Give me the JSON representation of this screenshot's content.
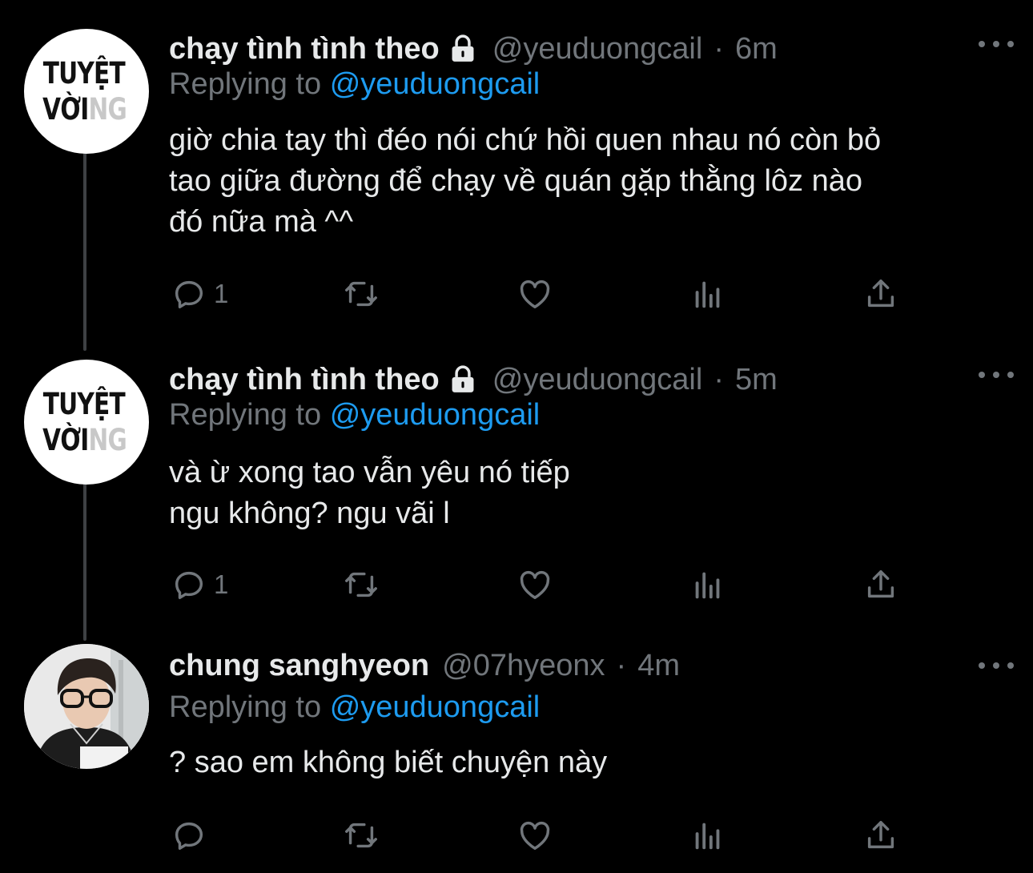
{
  "colors": {
    "background": "#000000",
    "text": "#e7e9ea",
    "muted": "#71767b",
    "accent": "#1d9bf0"
  },
  "tweets": [
    {
      "avatar": {
        "line1": "TUYỆT",
        "line2_main": "VỜI",
        "line2_faded": "NG"
      },
      "name": "chạy tình tình theo",
      "locked": true,
      "handle": "@yeuduongcail",
      "time": "6m",
      "reply_prefix": "Replying to",
      "reply_to": "@yeuduongcail",
      "text": "giờ chia tay thì đéo nói chứ hồi quen nhau nó còn bỏ\ntao giữa đường để chạy về quán gặp thằng lôz nào\nđó nữa mà ^^",
      "reply_count": "1"
    },
    {
      "avatar": {
        "line1": "TUYỆT",
        "line2_main": "VỜI",
        "line2_faded": "NG"
      },
      "name": "chạy tình tình theo",
      "locked": true,
      "handle": "@yeuduongcail",
      "time": "5m",
      "reply_prefix": "Replying to",
      "reply_to": "@yeuduongcail",
      "text": "và ừ xong tao vẫn yêu nó tiếp\nngu không? ngu vãi l",
      "reply_count": "1"
    },
    {
      "avatar": {
        "type": "photo"
      },
      "name": "chung sanghyeon",
      "locked": false,
      "handle": "@07hyeonx",
      "time": "4m",
      "reply_prefix": "Replying to",
      "reply_to": "@yeuduongcail",
      "text": "? sao em không biết chuyện này",
      "reply_count": ""
    }
  ],
  "icons": {
    "actions": [
      "reply-icon",
      "retweet-icon",
      "like-icon",
      "analytics-icon",
      "share-icon"
    ],
    "more": "more-options-icon",
    "lock": "lock-icon"
  }
}
